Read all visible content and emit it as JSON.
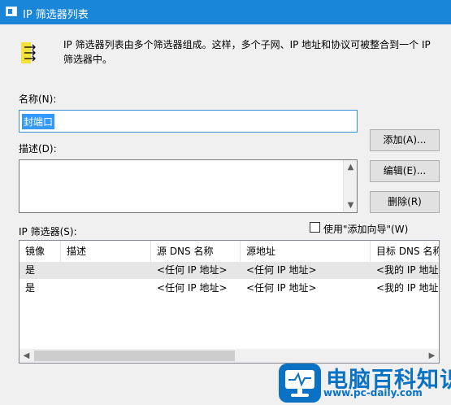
{
  "window": {
    "title": "IP 筛选器列表"
  },
  "intro": {
    "line1": "IP 筛选器列表由多个筛选器组成。这样，多个子网、IP 地址和协议可被整合到一个 IP",
    "line2": "筛选器中。",
    "icon": "filter-list-icon"
  },
  "name_field": {
    "label": "名称(N):",
    "value": "封端口"
  },
  "description_field": {
    "label": "描述(D):",
    "value": ""
  },
  "buttons": {
    "add": "添加(A)...",
    "edit": "编辑(E)...",
    "delete": "删除(R)"
  },
  "wizard_checkbox": {
    "label": "使用\"添加向导\"(W)",
    "checked": false
  },
  "filters": {
    "label": "IP 筛选器(S):",
    "columns": [
      "镜像",
      "描述",
      "源 DNS 名称",
      "源地址",
      "目标 DNS 名称"
    ],
    "rows": [
      [
        "是",
        "",
        "<任何 IP 地址>",
        "<任何 IP 地址>",
        "<我的 IP 地址>"
      ],
      [
        "是",
        "",
        "<任何 IP 地址>",
        "<任何 IP 地址>",
        "<我的 IP 地址>"
      ]
    ]
  },
  "watermark": {
    "title": "电脑百科知识",
    "url": "www.pc-daily.com",
    "color": "#0a72c4"
  },
  "colors": {
    "titlebar": "#1a86d9",
    "selection": "#3399ff",
    "dialog": "#f0f0f0"
  }
}
